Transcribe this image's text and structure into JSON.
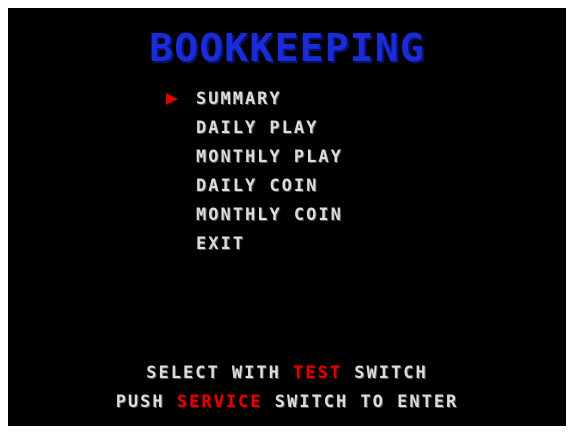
{
  "screen": {
    "title": "BOOKKEEPING",
    "colors": {
      "background": "#000000",
      "title": "#1a2bd8",
      "text": "#dcdcdc",
      "highlight": "#e00000"
    }
  },
  "menu": {
    "cursor_icon": "cursor-arrow-icon",
    "selected_index": 0,
    "items": [
      {
        "label": "SUMMARY"
      },
      {
        "label": "DAILY PLAY"
      },
      {
        "label": "MONTHLY PLAY"
      },
      {
        "label": "DAILY COIN"
      },
      {
        "label": "MONTHLY COIN"
      },
      {
        "label": "EXIT"
      }
    ]
  },
  "instructions": {
    "line1": {
      "pre": "SELECT WITH ",
      "key": "TEST",
      "post": " SWITCH"
    },
    "line2": {
      "pre": "PUSH ",
      "key": "SERVICE",
      "post": " SWITCH TO ENTER"
    }
  }
}
